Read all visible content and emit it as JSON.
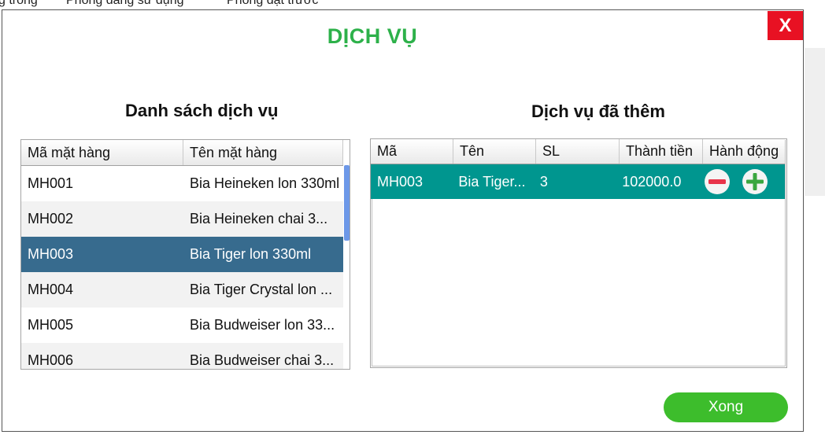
{
  "background": {
    "tabs": [
      "g trống",
      "Phòng đang sử dụng",
      "Phòng đặt trước"
    ]
  },
  "dialog": {
    "title": "DỊCH VỤ",
    "close_label": "X",
    "done_label": "Xong"
  },
  "services_list": {
    "title": "Danh sách dịch vụ",
    "columns": [
      "Mã mặt hàng",
      "Tên mặt hàng"
    ],
    "rows": [
      {
        "code": "MH001",
        "name": "Bia Heineken lon 330ml"
      },
      {
        "code": "MH002",
        "name": "Bia Heineken chai 3..."
      },
      {
        "code": "MH003",
        "name": "Bia Tiger lon 330ml"
      },
      {
        "code": "MH004",
        "name": "Bia Tiger Crystal lon ..."
      },
      {
        "code": "MH005",
        "name": "Bia Budweiser lon 33..."
      },
      {
        "code": "MH006",
        "name": "Bia Budweiser chai 3..."
      }
    ],
    "selected_code": "MH003"
  },
  "added_services": {
    "title": "Dịch vụ đã thêm",
    "columns": [
      "Mã",
      "Tên",
      "SL",
      "Thành tiền",
      "Hành động"
    ],
    "rows": [
      {
        "code": "MH003",
        "name": "Bia Tiger...",
        "qty": "3",
        "total": "102000.0"
      }
    ]
  },
  "icons": {
    "close": "close-icon",
    "minus": "minus-circle-icon",
    "plus": "plus-circle-icon"
  },
  "colors": {
    "title_green": "#2db14a",
    "close_red": "#e81123",
    "selected_row": "#376b8e",
    "added_row": "#00968f",
    "done_button": "#3dbd2c",
    "minus_red": "#e8344a",
    "plus_green": "#3aa63f"
  }
}
